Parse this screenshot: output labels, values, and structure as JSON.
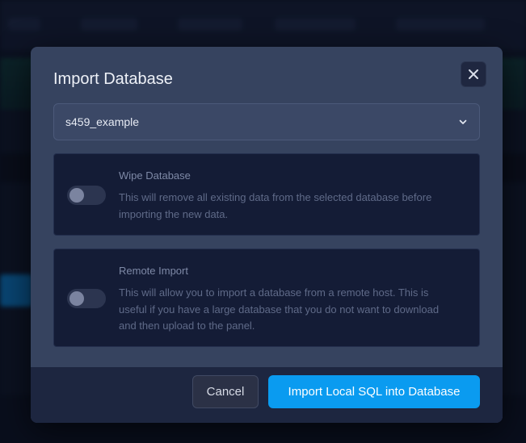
{
  "modal": {
    "title": "Import Database",
    "close_icon": "close-icon"
  },
  "select": {
    "value": "s459_example",
    "icon": "chevron-down-icon"
  },
  "options": [
    {
      "title": "Wipe Database",
      "description": "This will remove all existing data from the selected database before importing the new data.",
      "enabled": false
    },
    {
      "title": "Remote Import",
      "description": "This will allow you to import a database from a remote host. This is useful if you have a large database that you do not want to download and then upload to the panel.",
      "enabled": false
    }
  ],
  "footer": {
    "cancel_label": "Cancel",
    "import_label": "Import Local SQL into Database"
  },
  "colors": {
    "accent": "#0a9bf0",
    "modal_bg": "#36435f",
    "card_bg": "#141c36"
  }
}
